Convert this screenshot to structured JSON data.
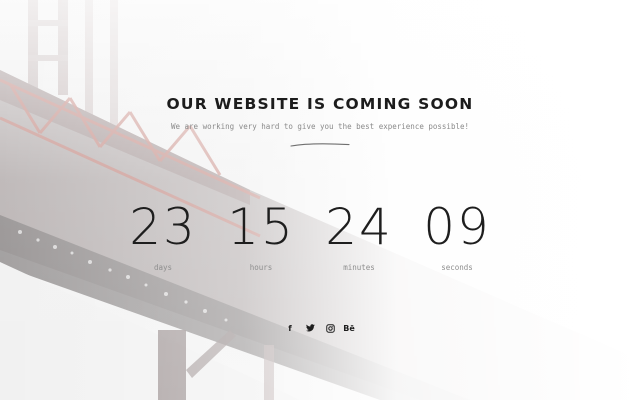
{
  "page": {
    "headline": "OUR WEBSITE IS COMING SOON",
    "tagline": "We are working very hard to give you the best experience possible!"
  },
  "countdown": [
    {
      "value": "23",
      "label": "days"
    },
    {
      "value": "15",
      "label": "hours"
    },
    {
      "value": "24",
      "label": "minutes"
    },
    {
      "value": "09",
      "label": "seconds"
    }
  ],
  "social": [
    {
      "icon": "facebook-icon",
      "glyph": "f"
    },
    {
      "icon": "twitter-icon",
      "glyph": ""
    },
    {
      "icon": "instagram-icon",
      "glyph": ""
    },
    {
      "icon": "behance-icon",
      "glyph": "Bē"
    }
  ],
  "colors": {
    "text": "#1e1e1e",
    "muted": "#8a8a8a",
    "bridge_accent": "#c98d86"
  }
}
